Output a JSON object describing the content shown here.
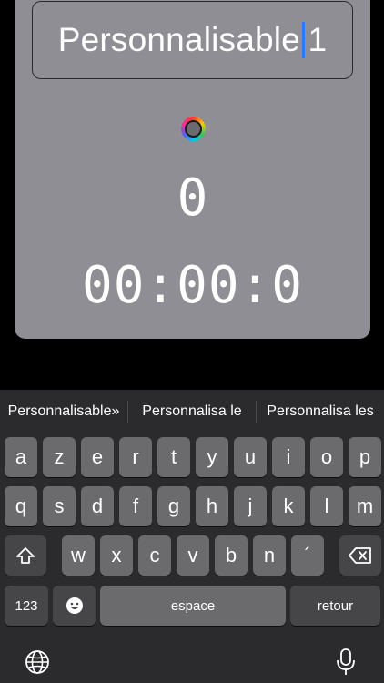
{
  "name_field": {
    "text_before_caret": "Personnalisable",
    "text_after_caret": "1"
  },
  "counter": {
    "value": "0"
  },
  "timer": {
    "value": "00:00:0"
  },
  "keyboard": {
    "suggestions": [
      "Personnalisable»",
      "Personnalisa le",
      "Personnalisa les"
    ],
    "row1": [
      "a",
      "z",
      "e",
      "r",
      "t",
      "y",
      "u",
      "i",
      "o",
      "p"
    ],
    "row2": [
      "q",
      "s",
      "d",
      "f",
      "g",
      "h",
      "j",
      "k",
      "l",
      "m"
    ],
    "row3": [
      "w",
      "x",
      "c",
      "v",
      "b",
      "n",
      "´"
    ],
    "numbers_label": "123",
    "space_label": "espace",
    "return_label": "retour",
    "icons": {
      "shift": "shift-icon",
      "delete": "delete-icon",
      "emoji": "emoji-icon",
      "globe": "globe-icon",
      "mic": "microphone-icon"
    }
  },
  "colors": {
    "card": "#8f8e94",
    "keyboard_bg": "#2b2b2d",
    "key": "#6b6b6e",
    "key_dark": "#464649",
    "caret": "#2a7cf6"
  }
}
